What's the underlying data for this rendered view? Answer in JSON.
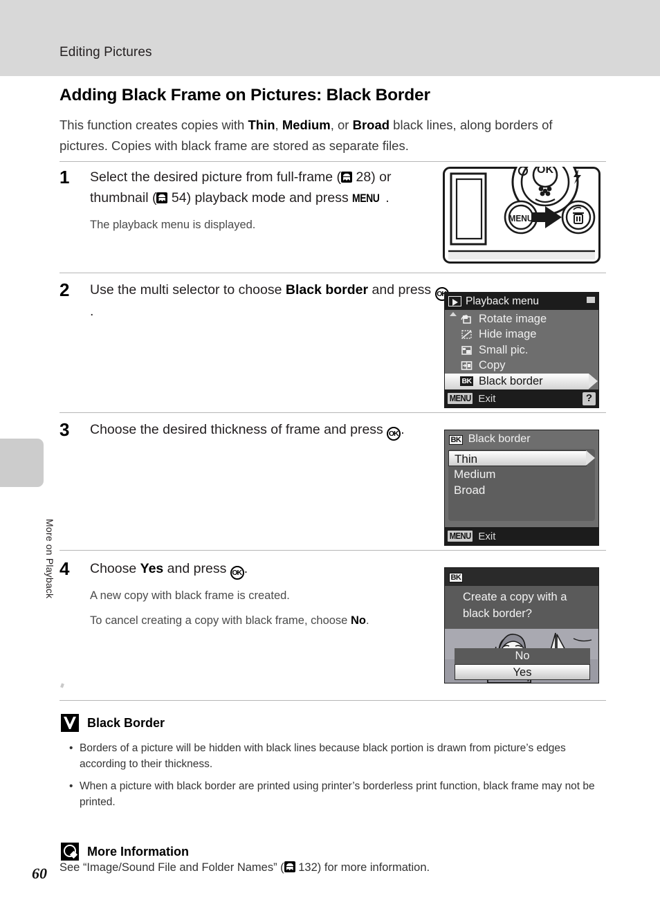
{
  "header": {
    "running_head": "Editing Pictures"
  },
  "side_tab": {
    "label": "More on Playback"
  },
  "section": {
    "title": "Adding Black Frame on Pictures: Black Border",
    "intro_before": "This function creates copies with ",
    "intro_b1": "Thin",
    "intro_sep1": ", ",
    "intro_b2": "Medium",
    "intro_sep2": ", or ",
    "intro_b3": "Broad",
    "intro_after": " black lines, along borders of pictures. Copies with black frame are stored as separate files."
  },
  "steps": [
    {
      "num": "1",
      "main_1": "Select the desired picture from full-frame (",
      "ref_1": "28",
      "main_2": ") or thumbnail (",
      "ref_2": "54",
      "main_3": ") playback mode and press ",
      "menu_key": "MENU",
      "main_4": ".",
      "sub": "The playback menu is displayed."
    },
    {
      "num": "2",
      "main_1": "Use the multi selector to choose ",
      "bold": "Black border",
      "main_2": " and press ",
      "ok_key": "OK",
      "main_3": "."
    },
    {
      "num": "3",
      "main_1": "Choose the desired thickness of frame and press ",
      "ok_key": "OK",
      "main_2": "."
    },
    {
      "num": "4",
      "main_1": "Choose ",
      "bold": "Yes",
      "main_2": " and press ",
      "ok_key": "OK",
      "main_3": ".",
      "sub_1": "A new copy with black frame is created.",
      "sub_2a": "To cancel creating a copy with black frame, choose ",
      "sub_2b": "No",
      "sub_2c": "."
    }
  ],
  "camera_figure": {
    "menu_button_label": "MENU",
    "ok_button_label": "OK",
    "delete_icon": "trash-icon",
    "macro_icon": "macro-flower-icon"
  },
  "lcd_playback_menu": {
    "title": "Playback menu",
    "title_icon": "playback-arrow-icon",
    "items": [
      {
        "label": "Rotate image",
        "icon": "rotate-image-icon",
        "selected": false
      },
      {
        "label": "Hide image",
        "icon": "hide-image-icon",
        "selected": false
      },
      {
        "label": "Small pic.",
        "icon": "small-picture-icon",
        "selected": false
      },
      {
        "label": "Copy",
        "icon": "copy-icon",
        "selected": false
      },
      {
        "label": "Black border",
        "icon": "bk-icon",
        "selected": true
      }
    ],
    "footer_badge": "MENU",
    "footer_label": "Exit",
    "help_badge": "?"
  },
  "lcd_black_border": {
    "title": "Black border",
    "title_icon": "bk-icon",
    "options": [
      {
        "label": "Thin",
        "selected": true
      },
      {
        "label": "Medium",
        "selected": false
      },
      {
        "label": "Broad",
        "selected": false
      }
    ],
    "footer_badge": "MENU",
    "footer_label": "Exit"
  },
  "lcd_confirm": {
    "title_icon": "bk-icon",
    "question_line1": "Create a copy with a",
    "question_line2": "black border?",
    "options": [
      {
        "label": "No",
        "selected": false
      },
      {
        "label": "Yes",
        "selected": true
      }
    ]
  },
  "note_caution": {
    "icon": "caution-checkmark-icon",
    "heading": "Black Border",
    "bullets": [
      "Borders of a picture will be hidden with black lines because black portion is drawn from picture’s edges according to their thickness.",
      "When a picture with black border are printed using printer’s borderless print function, black frame may not be printed."
    ]
  },
  "note_info": {
    "icon": "more-information-icon",
    "heading": "More Information",
    "text_1": "See “Image/Sound File and Folder Names” (",
    "ref": "132",
    "text_2": ") for more information."
  },
  "page_number": "60"
}
